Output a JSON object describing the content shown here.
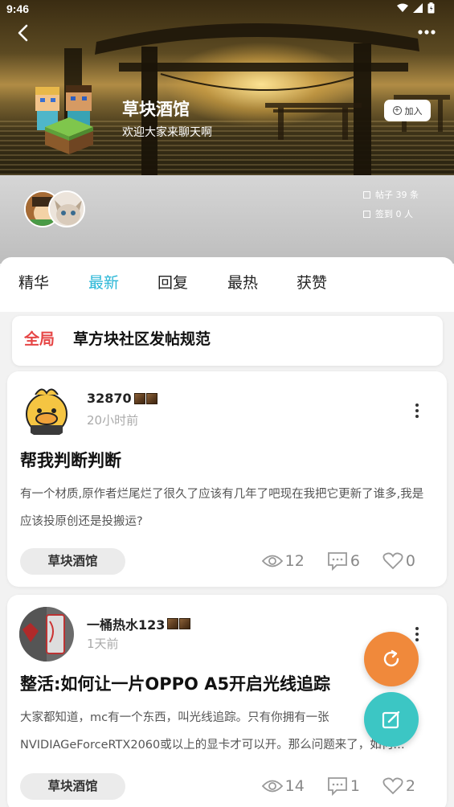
{
  "status_bar": {
    "time": "9:46"
  },
  "header": {
    "group_name": "草块酒馆",
    "group_desc": "欢迎大家来聊天啊",
    "join_label": "加入",
    "posts_stat": "帖子 39 条",
    "checkin_stat": "签到 0 人"
  },
  "tabs": [
    "精华",
    "最新",
    "回复",
    "最热",
    "获赞"
  ],
  "active_tab": "最新",
  "pinned": {
    "tag": "全局",
    "title": "草方块社区发帖规范"
  },
  "posts": [
    {
      "username": "32870",
      "time": "20小时前",
      "title": "帮我判断判断",
      "body": "有一个材质,原作者烂尾烂了很久了应该有几年了吧现在我把它更新了谁多,我是应该投原创还是投搬运?",
      "tag": "草块酒馆",
      "views": "12",
      "comments": "6",
      "likes": "0"
    },
    {
      "username": "一桶热水123",
      "time": "1天前",
      "title": "整活:如何让一片OPPO A5开启光线追踪",
      "body": "大家都知道，mc有一个东西，叫光线追踪。只有你拥有一张NVIDIAGeForceRTX2060或以上的显卡才可以开。那么问题来了，如何…",
      "tag": "草块酒馆",
      "views": "14",
      "comments": "1",
      "likes": "2"
    }
  ],
  "colors": {
    "accent": "#29b6d6",
    "pinned_tag": "#e64646",
    "fab_refresh": "#f0893b",
    "fab_write": "#3cc6c4"
  }
}
